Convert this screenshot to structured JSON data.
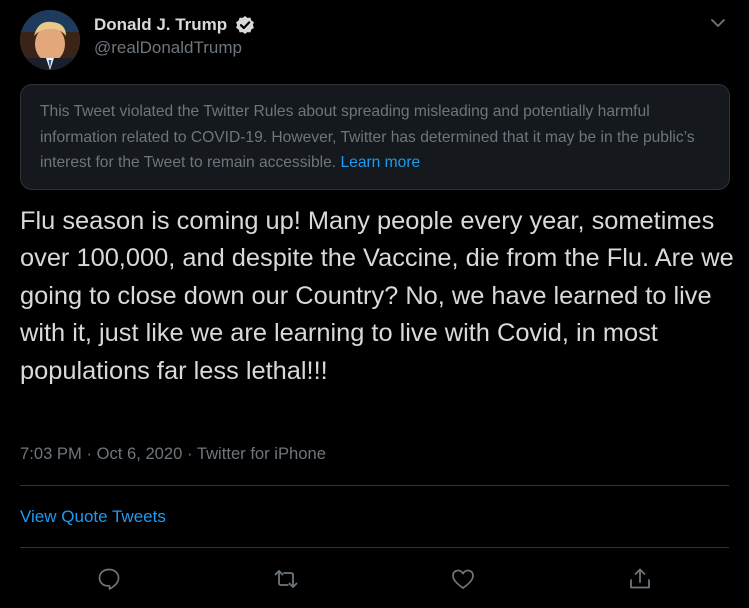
{
  "user": {
    "display_name": "Donald J. Trump",
    "handle": "@realDonaldTrump",
    "verified": true
  },
  "notice": {
    "text": "This Tweet violated the Twitter Rules about spreading misleading and potentially harmful information related to COVID-19. However, Twitter has determined that it may be in the public’s interest for the Tweet to remain accessible. ",
    "link_label": "Learn more"
  },
  "tweet": {
    "text": "Flu season is coming up! Many people every year, sometimes over 100,000, and despite the Vaccine, die from the Flu. Are we going to close down our Country? No, we have learned to live with it, just like we are learning to live with Covid, in most populations far less lethal!!!"
  },
  "meta": {
    "time": "7:03 PM",
    "date": "Oct 6, 2020",
    "source": "Twitter for iPhone"
  },
  "quotes_label": "View Quote Tweets",
  "actions": [
    "reply-icon",
    "retweet-icon",
    "like-icon",
    "share-icon"
  ],
  "colors": {
    "background": "#000000",
    "text": "#d9d9d9",
    "muted": "#6e767d",
    "link": "#1d9bf0",
    "notice_bg": "#15181c",
    "divider": "#2f3336"
  }
}
